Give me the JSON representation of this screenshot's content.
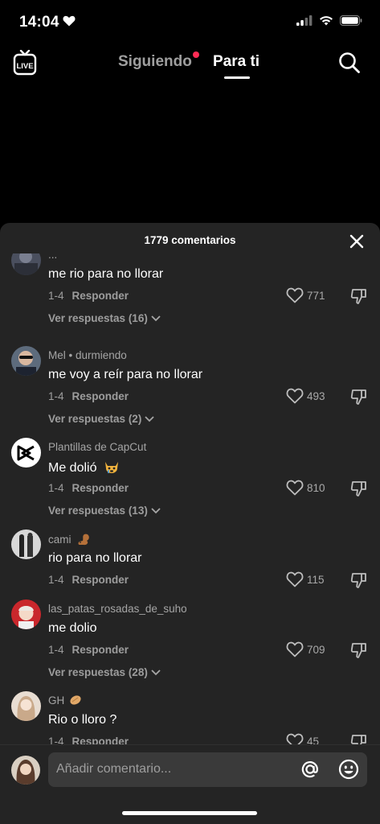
{
  "status_bar": {
    "time": "14:04"
  },
  "nav": {
    "live_label": "LIVE",
    "tab_following": "Siguiendo",
    "tab_for_you": "Para ti"
  },
  "sheet": {
    "comment_count": "1779 comentarios",
    "comments": [
      {
        "username": "...",
        "text": "me rio para no llorar",
        "date": "1-4",
        "reply": "Responder",
        "likes": "771",
        "replies": "Ver respuestas (16)"
      },
      {
        "username": "Mel • durmiendo",
        "text": "me voy a reír para no llorar",
        "date": "1-4",
        "reply": "Responder",
        "likes": "493",
        "replies": "Ver respuestas (2)"
      },
      {
        "username": "Plantillas de CapCut",
        "text": "Me dolió",
        "date": "1-4",
        "reply": "Responder",
        "likes": "810",
        "replies": "Ver respuestas (13)"
      },
      {
        "username": "cami",
        "text": "rio para no llorar",
        "date": "1-4",
        "reply": "Responder",
        "likes": "115"
      },
      {
        "username": "las_patas_rosadas_de_suho",
        "text": "me dolio",
        "date": "1-4",
        "reply": "Responder",
        "likes": "709",
        "replies": "Ver respuestas (28)"
      },
      {
        "username": "GH",
        "text": "Rio o lloro ?",
        "date": "1-4",
        "reply": "Responder",
        "likes": "45"
      }
    ]
  },
  "input": {
    "placeholder": "Añadir comentario..."
  },
  "colors": {
    "accent_dot": "#fe2c55",
    "sheet_bg": "#242424",
    "input_bg": "#3a3a3a"
  }
}
